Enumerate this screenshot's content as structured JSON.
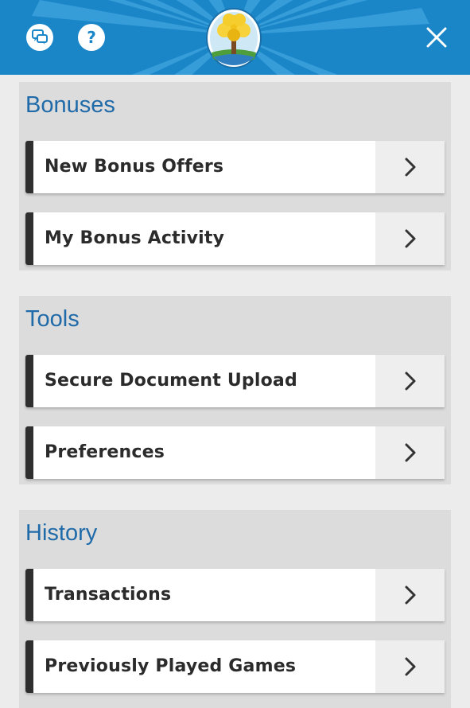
{
  "header": {
    "chat_icon": "chat-bubbles-icon",
    "help_label": "?",
    "logo_icon": "golden-tree-logo",
    "close_icon": "close-icon",
    "brand_color": "#1a86c8"
  },
  "sections": [
    {
      "title": "Bonuses",
      "items": [
        {
          "label": "New Bonus Offers"
        },
        {
          "label": "My Bonus Activity"
        }
      ]
    },
    {
      "title": "Tools",
      "items": [
        {
          "label": "Secure Document Upload"
        },
        {
          "label": "Preferences"
        }
      ]
    },
    {
      "title": "History",
      "items": [
        {
          "label": "Transactions"
        },
        {
          "label": "Previously Played Games"
        }
      ]
    }
  ],
  "colors": {
    "section_title": "#1f6aa8",
    "item_accent": "#2f2f2f",
    "section_bg": "#dcdcdc",
    "page_bg": "#ececec"
  }
}
